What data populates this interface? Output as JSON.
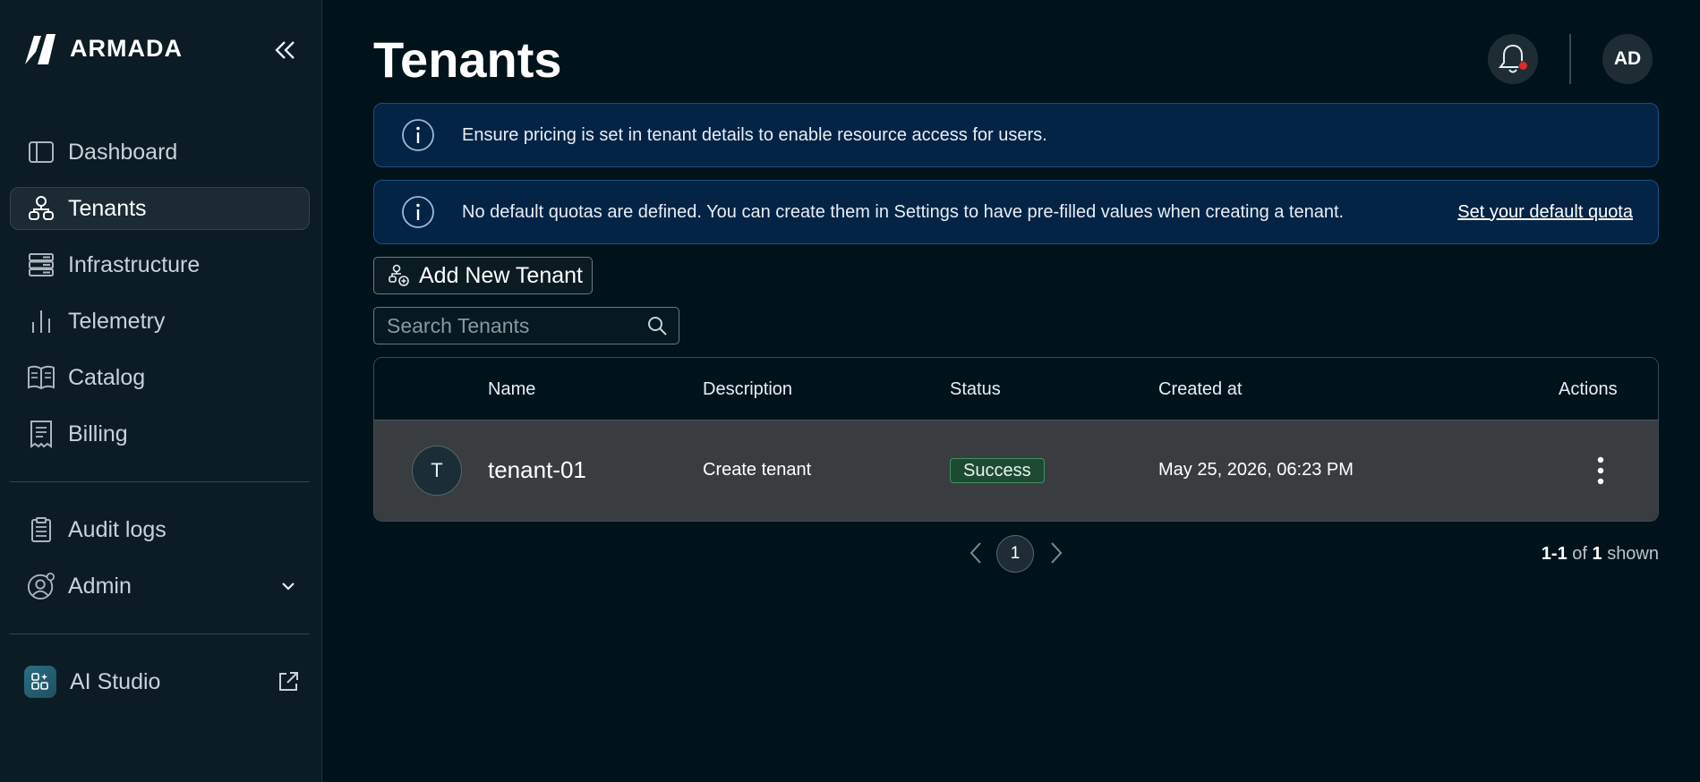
{
  "brand": {
    "name": "ARMADA"
  },
  "sidebar": {
    "items": [
      {
        "label": "Dashboard",
        "icon": "dashboard-icon"
      },
      {
        "label": "Tenants",
        "icon": "tenants-icon",
        "active": true
      },
      {
        "label": "Infrastructure",
        "icon": "server-icon"
      },
      {
        "label": "Telemetry",
        "icon": "chart-bars-icon"
      },
      {
        "label": "Catalog",
        "icon": "catalog-icon"
      },
      {
        "label": "Billing",
        "icon": "receipt-icon"
      }
    ],
    "secondary": [
      {
        "label": "Audit logs",
        "icon": "clipboard-icon"
      },
      {
        "label": "Admin",
        "icon": "user-gear-icon"
      }
    ],
    "external": {
      "label": "AI Studio",
      "icon": "ai-studio-icon"
    }
  },
  "header": {
    "title": "Tenants",
    "avatar_initials": "AD"
  },
  "banners": {
    "pricing": {
      "text": "Ensure pricing is set in tenant details to enable resource access for users."
    },
    "quotas": {
      "text": "No default quotas are defined. You can create them in Settings to have pre-filled values when creating a tenant.",
      "link": "Set your default quota"
    }
  },
  "toolbar": {
    "add_label": "Add New Tenant",
    "search_placeholder": "Search Tenants"
  },
  "table": {
    "columns": [
      "Name",
      "Description",
      "Status",
      "Created at",
      "Actions"
    ],
    "rows": [
      {
        "initial": "T",
        "name": "tenant-01",
        "description": "Create tenant",
        "status": "Success",
        "created_at": "May 25, 2026, 06:23 PM"
      }
    ]
  },
  "pagination": {
    "current_page": "1",
    "range": "1-1",
    "of": "of",
    "total": "1",
    "shown": "shown"
  },
  "colors": {
    "background": "#01131a",
    "sidebar": "#0c1c24",
    "banner": "#042446",
    "success": "#1e4a34",
    "notification": "#e0272a"
  }
}
